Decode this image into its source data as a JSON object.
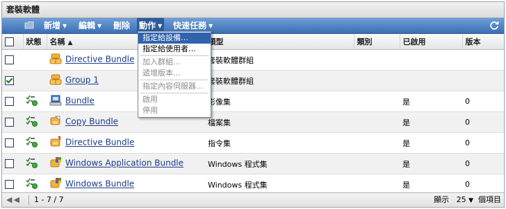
{
  "panel": {
    "title": "套裝軟體"
  },
  "toolbar": {
    "items": [
      {
        "label": "新增",
        "arrow": "▼"
      },
      {
        "label": "編輯",
        "arrow": "▼"
      },
      {
        "label": "刪除",
        "arrow": ""
      },
      {
        "label": "動作",
        "arrow": "▼"
      },
      {
        "label": "快速任務",
        "arrow": "▼"
      }
    ],
    "icons": {
      "folder": "folder-icon",
      "refresh": "refresh-icon"
    }
  },
  "table": {
    "columns": {
      "status": "狀態",
      "name": "名稱",
      "type": "類型",
      "category": "類別",
      "enabled": "已啟用",
      "version": "版本"
    },
    "sort_indicator": "▲",
    "rows": [
      {
        "checked": false,
        "status_icon": "",
        "icon": "bundle-group-icon",
        "name": "Directive Bundle",
        "type": "套裝軟體群組",
        "category": "",
        "enabled": "",
        "version": ""
      },
      {
        "checked": true,
        "status_icon": "",
        "icon": "bundle-group-icon",
        "name": "Group 1",
        "type": "套裝軟體群組",
        "category": "",
        "enabled": "",
        "version": ""
      },
      {
        "checked": false,
        "status_icon": "status-ok-icon",
        "icon": "imaging-bundle-icon",
        "name": "Bundle",
        "type": "影像集",
        "category": "",
        "enabled": "是",
        "version": "0"
      },
      {
        "checked": false,
        "status_icon": "status-ok-icon",
        "icon": "file-bundle-icon",
        "name": "Copy Bundle",
        "type": "檔案集",
        "category": "",
        "enabled": "是",
        "version": "0"
      },
      {
        "checked": false,
        "status_icon": "status-ok-icon",
        "icon": "directive-bundle-icon",
        "name": "Directive Bundle",
        "type": "指令集",
        "category": "",
        "enabled": "是",
        "version": "0"
      },
      {
        "checked": false,
        "status_icon": "status-ok-icon",
        "icon": "windows-app-bundle-icon",
        "name": "Windows Application Bundle",
        "type": "Windows 程式集",
        "category": "",
        "enabled": "是",
        "version": "0"
      },
      {
        "checked": false,
        "status_icon": "status-ok-icon",
        "icon": "windows-bundle-icon",
        "name": "Windows Bundle",
        "type": "Windows 程式集",
        "category": "",
        "enabled": "是",
        "version": "0"
      }
    ]
  },
  "menu": {
    "items": [
      {
        "label": "指定給設備…",
        "state": "hover"
      },
      {
        "label": "指定給使用者…",
        "state": "enabled"
      },
      {
        "label": "加入群組…",
        "state": "disabled"
      },
      {
        "label": "遞增版本…",
        "state": "disabled"
      },
      {
        "label": "指定內容伺服器…",
        "state": "disabled"
      },
      {
        "label": "啟用",
        "state": "disabled"
      },
      {
        "label": "停用",
        "state": "disabled"
      }
    ]
  },
  "footer": {
    "pager_arrows": "◀◀",
    "range": "1 - 7 / 7",
    "show_label": "顯示",
    "page_size": "25",
    "page_size_arrow": "▼",
    "items_label": "個項目"
  },
  "colors": {
    "toolbar": "#3a6fb3",
    "link": "#1a3c8a",
    "menu_highlight": "#2f63ad"
  }
}
